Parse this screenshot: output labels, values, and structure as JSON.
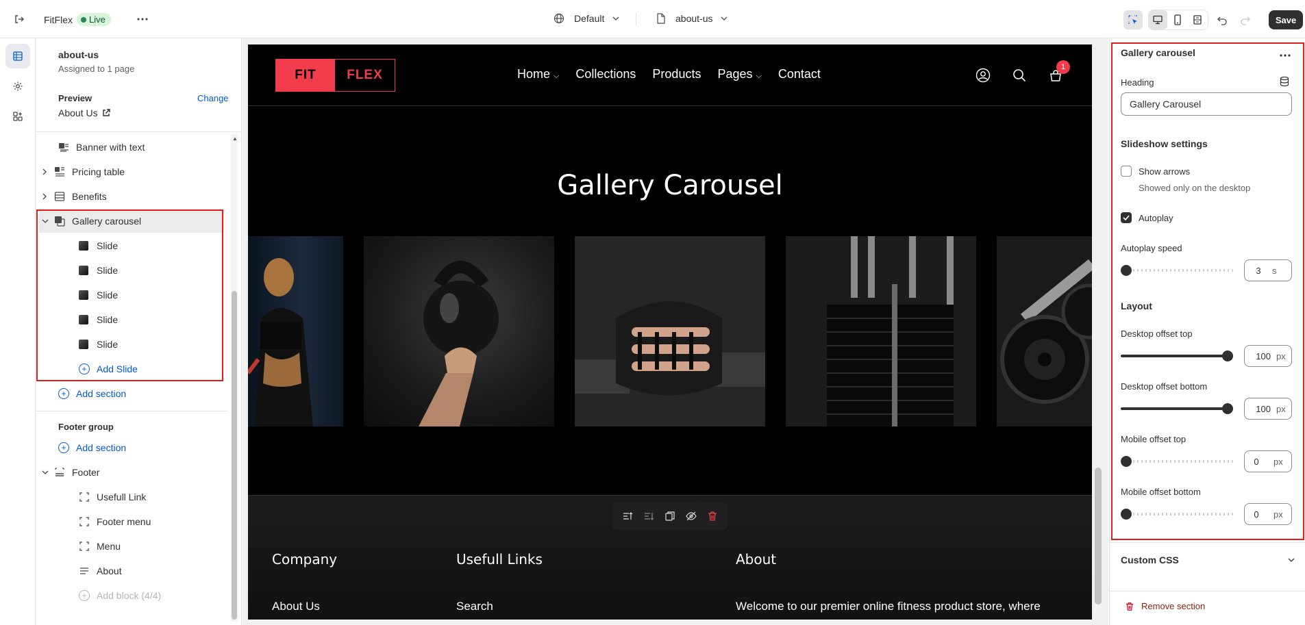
{
  "topbar": {
    "store_name": "FitFlex",
    "status_badge": "Live",
    "theme_select": "Default",
    "page_select": "about-us",
    "save_label": "Save"
  },
  "sidebar": {
    "template_name": "about-us",
    "template_assigned": "Assigned to 1 page",
    "preview_label": "Preview",
    "preview_change": "Change",
    "preview_page": "About Us",
    "sections": [
      {
        "label": "Banner with text"
      },
      {
        "label": "Pricing table"
      },
      {
        "label": "Benefits"
      },
      {
        "label": "Gallery carousel"
      }
    ],
    "slides": [
      "Slide",
      "Slide",
      "Slide",
      "Slide",
      "Slide"
    ],
    "add_slide": "Add Slide",
    "add_section": "Add section",
    "footer_group_label": "Footer group",
    "footer_add_section": "Add section",
    "footer_label": "Footer",
    "footer_blocks": [
      "Usefull Link",
      "Footer menu",
      "Menu",
      "About"
    ],
    "add_block_disabled": "Add block (4/4)"
  },
  "preview": {
    "logo_left": "FIT",
    "logo_right": "FLEX",
    "nav": [
      "Home",
      "Collections",
      "Products",
      "Pages",
      "Contact"
    ],
    "cart_count": "1",
    "gallery_title": "Gallery Carousel",
    "footer_cols": [
      {
        "title": "Company",
        "first": "About Us"
      },
      {
        "title": "Usefull Links",
        "first": "Search"
      },
      {
        "title": "About",
        "first": "Welcome to our premier online fitness product store, where"
      }
    ]
  },
  "panel": {
    "section_title": "Gallery carousel",
    "heading_label": "Heading",
    "heading_value": "Gallery Carousel",
    "slideshow_title": "Slideshow settings",
    "show_arrows_label": "Show arrows",
    "show_arrows_checked": false,
    "show_arrows_help": "Showed only on the desktop",
    "autoplay_label": "Autoplay",
    "autoplay_checked": true,
    "autoplay_speed_label": "Autoplay speed",
    "autoplay_speed_value": "3",
    "autoplay_speed_unit": "s",
    "layout_title": "Layout",
    "desktop_top_label": "Desktop offset top",
    "desktop_top_value": "100",
    "desktop_bottom_label": "Desktop offset bottom",
    "desktop_bottom_value": "100",
    "mobile_top_label": "Mobile offset top",
    "mobile_top_value": "0",
    "mobile_bottom_label": "Mobile offset bottom",
    "mobile_bottom_value": "0",
    "px_unit": "px",
    "custom_css_label": "Custom CSS",
    "remove_section_label": "Remove section"
  },
  "colors": {
    "accent": "#005bd3",
    "brand_red": "#f23c4c",
    "highlight": "#e01e1e",
    "live_green": "#29845a"
  }
}
